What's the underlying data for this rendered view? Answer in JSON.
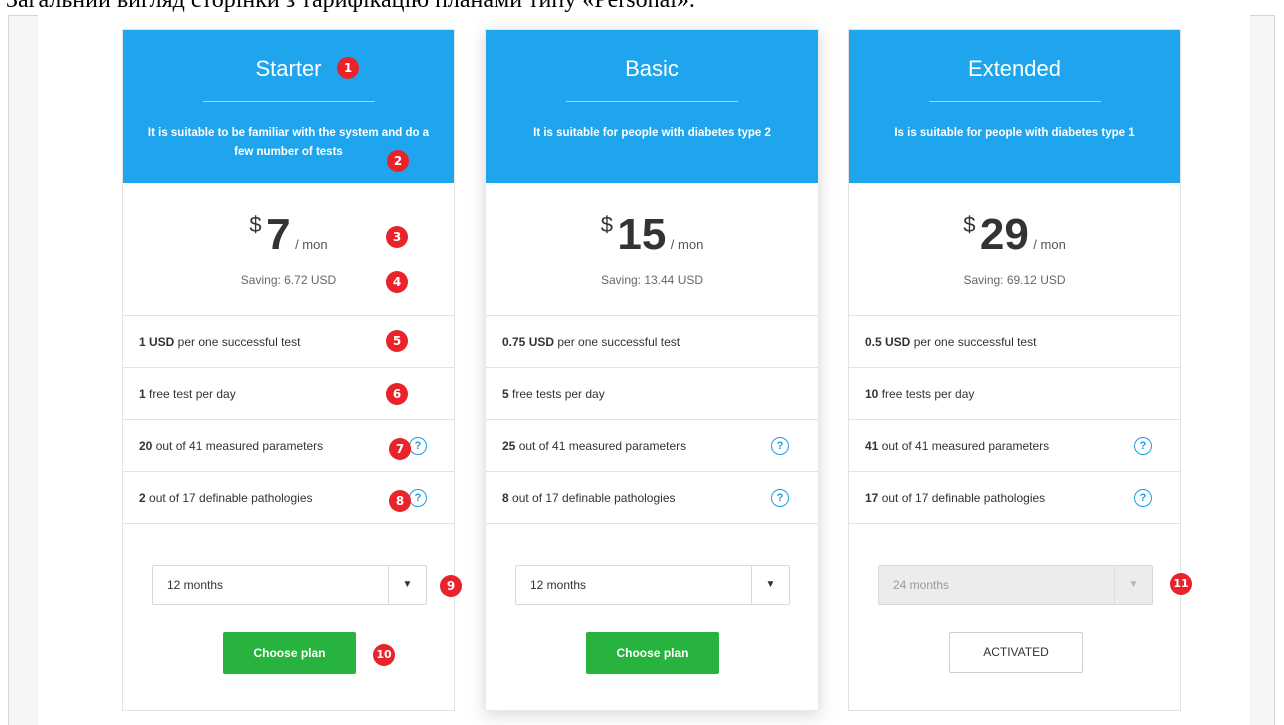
{
  "caption": "Загальний вигляд сторінки з тарифікацію планами типу «Personal».",
  "accent_colors": {
    "header_blue": "#1ea5ee",
    "button_green": "#28b33f",
    "help_blue": "#1e9be6",
    "marker_red": "#e8232a"
  },
  "plans": [
    {
      "title": "Starter",
      "description": "It is suitable to be familiar with the system and do a few number of tests",
      "currency": "$",
      "price": "7",
      "period": "/ mon",
      "saving": "Saving: 6.72 USD",
      "features": [
        {
          "bold": "1 USD",
          "text": " per one successful test"
        },
        {
          "bold": "1",
          "text": " free test per day"
        },
        {
          "bold": "20",
          "text": " out of 41 measured parameters"
        },
        {
          "bold": "2",
          "text": " out of 17 definable pathologies"
        }
      ],
      "select_value": "12 months",
      "action_label": "Choose plan"
    },
    {
      "title": "Basic",
      "description": "It is suitable for people with diabetes type 2",
      "currency": "$",
      "price": "15",
      "period": "/ mon",
      "saving": "Saving: 13.44 USD",
      "features": [
        {
          "bold": "0.75 USD",
          "text": " per one successful test"
        },
        {
          "bold": "5",
          "text": " free tests per day"
        },
        {
          "bold": "25",
          "text": " out of 41 measured parameters"
        },
        {
          "bold": "8",
          "text": " out of 17 definable pathologies"
        }
      ],
      "select_value": "12 months",
      "action_label": "Choose plan"
    },
    {
      "title": "Extended",
      "description": "Is is suitable for people with diabetes type 1",
      "currency": "$",
      "price": "29",
      "period": "/ mon",
      "saving": "Saving: 69.12 USD",
      "features": [
        {
          "bold": "0.5 USD",
          "text": " per one successful test"
        },
        {
          "bold": "10",
          "text": " free tests per day"
        },
        {
          "bold": "41",
          "text": " out of 41 measured parameters"
        },
        {
          "bold": "17",
          "text": " out of 17 definable pathologies"
        }
      ],
      "select_value": "24 months",
      "action_label": "ACTIVATED"
    }
  ],
  "help_icon_glyph": "?",
  "select_arrow_glyph": "▼",
  "markers": [
    "1",
    "2",
    "3",
    "4",
    "5",
    "6",
    "7",
    "8",
    "9",
    "10",
    "11"
  ]
}
